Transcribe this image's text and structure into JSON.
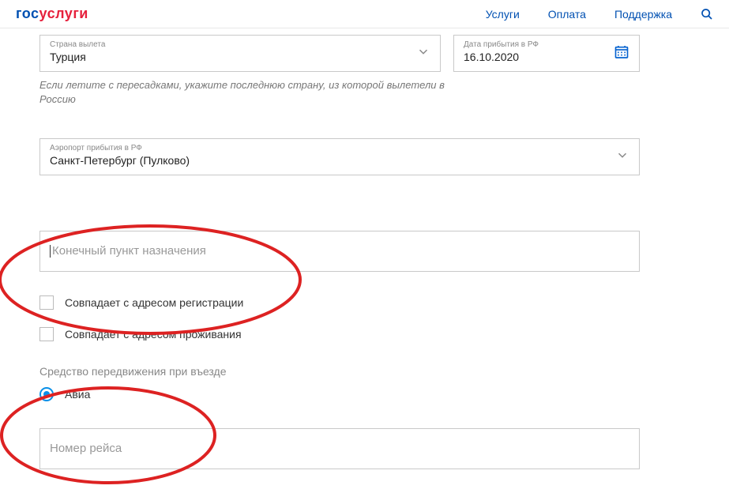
{
  "header": {
    "logo_part1": "гос",
    "logo_part2": "услуги",
    "nav": {
      "services": "Услуги",
      "payment": "Оплата",
      "support": "Поддержка"
    }
  },
  "country": {
    "label": "Страна вылета",
    "value": "Турция"
  },
  "arrival_date": {
    "label": "Дата прибытия в РФ",
    "value": "16.10.2020"
  },
  "hint_country": "Если летите с пересадками, укажите последнюю страну, из которой вылетели в Россию",
  "airport": {
    "label": "Аэропорт прибытия в РФ",
    "value": "Санкт-Петербург (Пулково)"
  },
  "destination_placeholder": "Конечный пункт назначения",
  "checkbox_registration": "Совпадает с адресом регистрации",
  "checkbox_residence": "Совпадает с адресом проживания",
  "vehicle_label": "Средство передвижения при въезде",
  "vehicle_avia": "Авиа",
  "flight_placeholder": "Номер рейса"
}
